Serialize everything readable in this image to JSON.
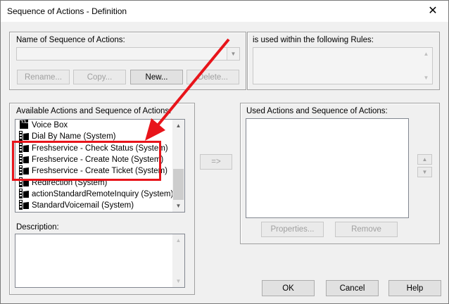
{
  "window": {
    "title": "Sequence of Actions - Definition",
    "close_glyph": "✕"
  },
  "name_group": {
    "label": "Name of Sequence of Actions:",
    "dropdown_value": "",
    "buttons": {
      "rename": "Rename...",
      "copy": "Copy...",
      "new": "New...",
      "delete": "Delete..."
    }
  },
  "rules_group": {
    "label": "is used within the following Rules:"
  },
  "available_group": {
    "label": "Available Actions and Sequence of Actions:",
    "items": [
      {
        "label": "Voice Box",
        "icon": "clapperboard-icon"
      },
      {
        "label": "Dial By Name (System)",
        "icon": "film-action-icon"
      },
      {
        "label": "Freshservice - Check Status (System)",
        "icon": "film-action-icon"
      },
      {
        "label": "Freshservice - Create Note (System)",
        "icon": "film-action-icon"
      },
      {
        "label": "Freshservice - Create Ticket (System)",
        "icon": "film-action-icon"
      },
      {
        "label": "Redirection (System)",
        "icon": "film-action-icon"
      },
      {
        "label": "actionStandardRemoteInquiry (System)",
        "icon": "film-action-icon"
      },
      {
        "label": "StandardVoicemail (System)",
        "icon": "film-action-icon"
      }
    ],
    "description_label": "Description:"
  },
  "transfer_button": {
    "label": "=>"
  },
  "used_group": {
    "label": "Used Actions and Sequence of Actions:",
    "buttons": {
      "properties": "Properties...",
      "remove": "Remove"
    }
  },
  "footer": {
    "ok": "OK",
    "cancel": "Cancel",
    "help": "Help"
  },
  "colors": {
    "highlight_box": "#e8141a",
    "arrow": "#e8141a"
  }
}
